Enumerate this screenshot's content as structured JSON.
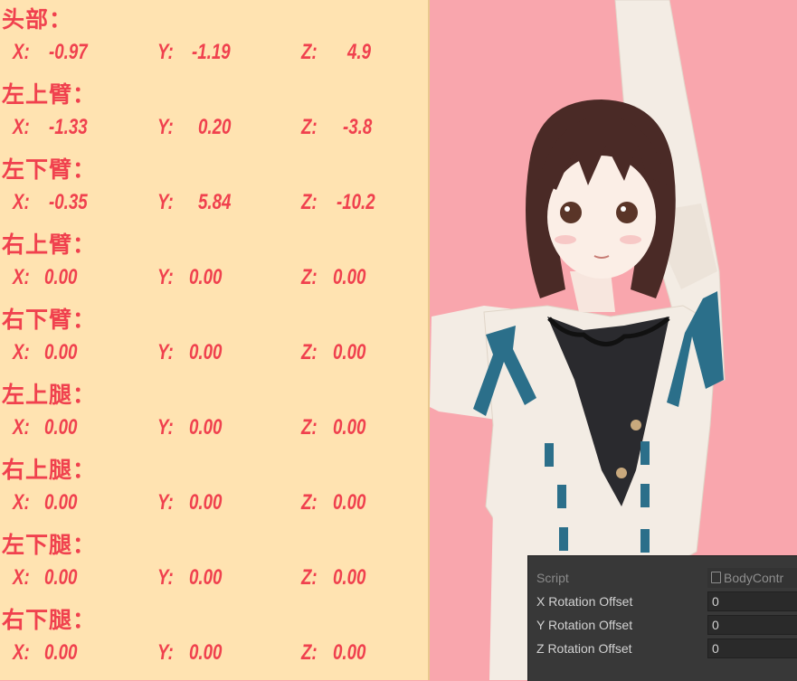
{
  "parts": [
    {
      "label": "头部：",
      "x": "-0.97",
      "y": "-1.19",
      "z": "4.9"
    },
    {
      "label": "左上臂：",
      "x": "-1.33",
      "y": "0.20",
      "z": "-3.8"
    },
    {
      "label": "左下臂：",
      "x": "-0.35",
      "y": "5.84",
      "z": "-10.2"
    },
    {
      "label": "右上臂：",
      "x": "0.00",
      "y": "0.00",
      "z": "0.00"
    },
    {
      "label": "右下臂：",
      "x": "0.00",
      "y": "0.00",
      "z": "0.00"
    },
    {
      "label": "左上腿：",
      "x": "0.00",
      "y": "0.00",
      "z": "0.00"
    },
    {
      "label": "右上腿：",
      "x": "0.00",
      "y": "0.00",
      "z": "0.00"
    },
    {
      "label": "左下腿：",
      "x": "0.00",
      "y": "0.00",
      "z": "0.00"
    },
    {
      "label": "右下腿：",
      "x": "0.00",
      "y": "0.00",
      "z": "0.00"
    }
  ],
  "axis_labels": {
    "x": "X:",
    "y": "Y:",
    "z": "Z:"
  },
  "inspector": {
    "script_label": "Script",
    "script_value": "BodyContr",
    "x_offset_label": "X Rotation Offset",
    "x_offset_value": "0",
    "y_offset_label": "Y Rotation Offset",
    "y_offset_value": "0",
    "z_offset_label": "Z Rotation Offset",
    "z_offset_value": "0"
  },
  "colors": {
    "panel_bg": "#ffe3b1",
    "text_red": "#f0414e",
    "scene_bg": "#f9a6ad",
    "inspector_bg": "#383838"
  }
}
